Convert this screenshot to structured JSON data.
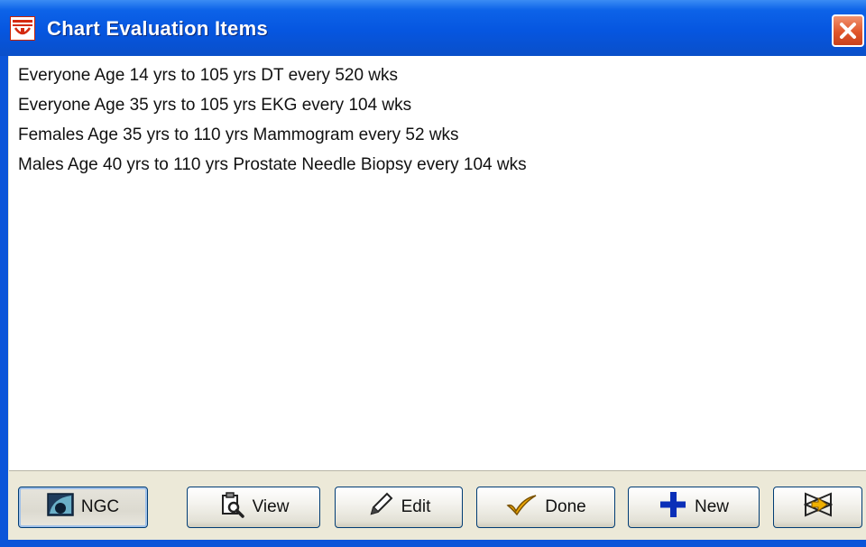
{
  "window": {
    "title": "Chart Evaluation Items",
    "close_icon": "close-icon",
    "app_icon": "app-logo-icon"
  },
  "list": {
    "items": [
      "Everyone Age 14 yrs  to 105 yrs DT every 520 wks",
      "Everyone Age 35 yrs  to 105 yrs EKG every 104 wks",
      "Females Age 35 yrs  to 110 yrs Mammogram every 52 wks",
      "Males Age 40 yrs  to 110 yrs Prostate Needle Biopsy every 104 wks"
    ]
  },
  "buttons": {
    "ngc": {
      "label": "NGC",
      "icon": "ngc-icon"
    },
    "view": {
      "label": "View",
      "icon": "clipboard-magnifier-icon"
    },
    "edit": {
      "label": "Edit",
      "icon": "pencil-icon"
    },
    "done": {
      "label": "Done",
      "icon": "checkmark-icon"
    },
    "new": {
      "label": "New",
      "icon": "plus-icon"
    },
    "exit": {
      "icon": "exit-arrow-icon"
    }
  },
  "colors": {
    "titlebar": "#0656e0",
    "close": "#e0562b",
    "accent_blue": "#0a2fb8",
    "check_orange": "#e8a000"
  }
}
